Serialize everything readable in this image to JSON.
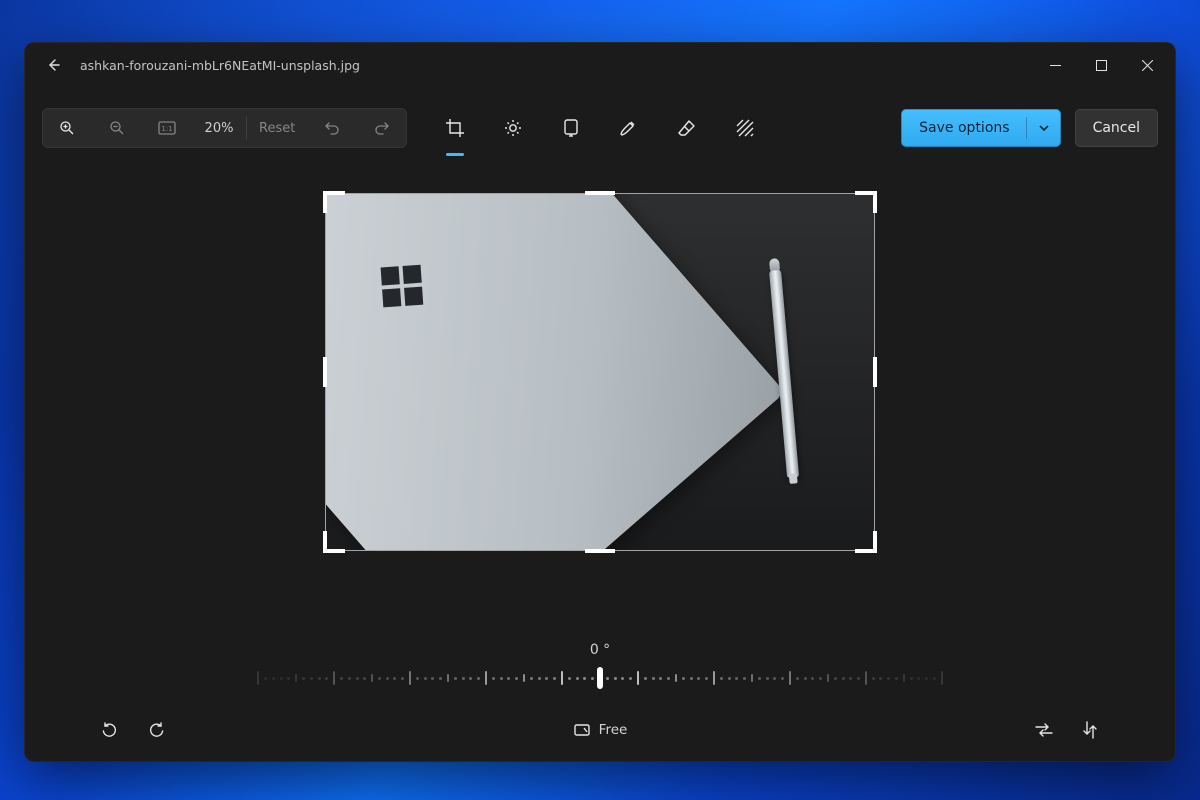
{
  "window": {
    "filename": "ashkan-forouzani-mbLr6NEatMI-unsplash.jpg"
  },
  "toolbar": {
    "zoom_percent": "20%",
    "reset_label": "Reset",
    "save_label": "Save options",
    "cancel_label": "Cancel"
  },
  "crop": {
    "angle_label": "0 °",
    "aspect_label": "Free"
  },
  "colors": {
    "accent": "#38b6ff"
  }
}
